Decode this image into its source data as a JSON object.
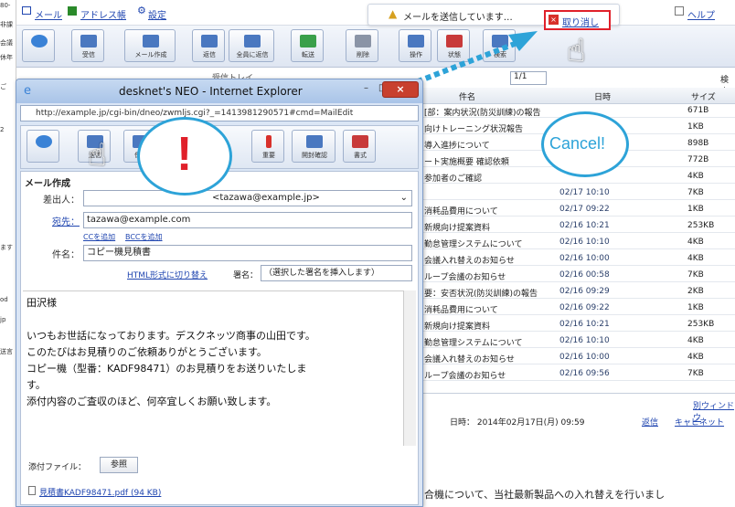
{
  "left_strip": [
    "80-",
    "非課",
    "会議",
    "休年",
    "ご",
    "2",
    "ます",
    "od",
    "jp",
    "送言"
  ],
  "topbar": {
    "links": [
      "メール",
      "アドレス帳",
      "設定"
    ],
    "help": "ヘルプ",
    "notify_text": "メールを送信しています…",
    "cancel_label": "取り消し"
  },
  "main_toolbar": [
    {
      "label": "受信",
      "icon": "inbox-icon"
    },
    {
      "label": "メール作成",
      "icon": "compose-icon"
    },
    {
      "label": "返信",
      "icon": "reply-icon"
    },
    {
      "label": "全員に返信",
      "icon": "reply-all-icon"
    },
    {
      "label": "転送",
      "icon": "forward-icon"
    },
    {
      "label": "削除",
      "icon": "delete-icon"
    },
    {
      "label": "操作",
      "icon": "operate-icon"
    },
    {
      "label": "状態",
      "icon": "status-icon"
    },
    {
      "label": "検索",
      "icon": "search-icon"
    }
  ],
  "folder_label": "受信トレイ",
  "pager": {
    "page": "1/1",
    "search": "検索"
  },
  "list_columns": {
    "subject": "件名",
    "date": "日時",
    "size": "サイズ"
  },
  "list_rows": [
    {
      "subject": "[部：案内状況(防災訓練)の報告",
      "date": "",
      "size": "671B"
    },
    {
      "subject": "向けトレーニング状況報告",
      "date": "",
      "size": "1KB"
    },
    {
      "subject": "導入進捗について",
      "date": "",
      "size": "898B"
    },
    {
      "subject": "ート実施概要 確認依頼",
      "date": "",
      "size": "772B"
    },
    {
      "subject": "参加者のご確認",
      "date": "",
      "size": "4KB"
    },
    {
      "subject": "",
      "date": "02/17 10:10",
      "size": "7KB"
    },
    {
      "subject": "消耗品費用について",
      "date": "02/17 09:22",
      "size": "1KB"
    },
    {
      "subject": "新規向け提案資料",
      "date": "02/16 10:21",
      "size": "253KB"
    },
    {
      "subject": "勤怠管理システムについて",
      "date": "02/16 10:10",
      "size": "4KB"
    },
    {
      "subject": "会議入れ替えのお知らせ",
      "date": "02/16 10:00",
      "size": "4KB"
    },
    {
      "subject": "ループ会議のお知らせ",
      "date": "02/16 00:58",
      "size": "7KB"
    },
    {
      "subject": "要：安否状況(防災訓練)の報告",
      "date": "02/16 09:29",
      "size": "2KB"
    },
    {
      "subject": "消耗品費用について",
      "date": "02/16 09:22",
      "size": "1KB"
    },
    {
      "subject": "新規向け提案資料",
      "date": "02/16 10:21",
      "size": "253KB"
    },
    {
      "subject": "勤怠管理システムについて",
      "date": "02/16 10:10",
      "size": "4KB"
    },
    {
      "subject": "会議入れ替えのお知らせ",
      "date": "02/16 10:00",
      "size": "4KB"
    },
    {
      "subject": "ループ会議のお知らせ",
      "date": "02/16 09:56",
      "size": "7KB"
    }
  ],
  "detail": {
    "separate_window": "別ウィンドウ",
    "date_line": "日時： 2014年02月17日(月) 09:59",
    "reply_link": "返信",
    "cabinet_link": "キャビネット",
    "body_snippet": "合機について、当社最新製品への入れ替えを行いまし"
  },
  "popup": {
    "title": "desknet's NEO - Internet Explorer",
    "url": "http://example.jp/cgi-bin/dneo/zwmljs.cgi?_=1413981290571#cmd=MailEdit",
    "toolbar": [
      "送信",
      "保存",
      "",
      "重要",
      "開封確認",
      "書式"
    ],
    "section": "メール作成",
    "from_label": "差出人：",
    "from_value": "<tazawa@example.jp>",
    "to_label": "宛先：",
    "to_value": "tazawa@example.com",
    "cc_link": "CCを追加",
    "bcc_link": "BCCを追加",
    "subject_label": "件名：",
    "subject_value": "コピー機見積書",
    "html_link": "HTML形式に切り替え",
    "signature_label": "署名：",
    "signature_value": "（選択した署名を挿入します）",
    "body_lines": [
      "田沢様",
      "",
      "いつもお世話になっております。デスクネッツ商事の山田です。",
      "このたびはお見積りのご依頼ありがとうございます。",
      "コピー機（型番：KADF98471）のお見積りをお送りいたしま",
      "す。",
      "添付内容のご査収のほど、何卒宜しくお願い致します。"
    ],
    "attach_label": "添付ファイル：",
    "attach_button": "参照",
    "attach_file": "見積書KADF98471.pdf (94 KB)"
  },
  "callouts": {
    "warning": "!",
    "cancel": "Cancel!"
  },
  "colors": {
    "accent": "#2da3d8",
    "warning": "#e0202a",
    "link": "#2046b0"
  }
}
